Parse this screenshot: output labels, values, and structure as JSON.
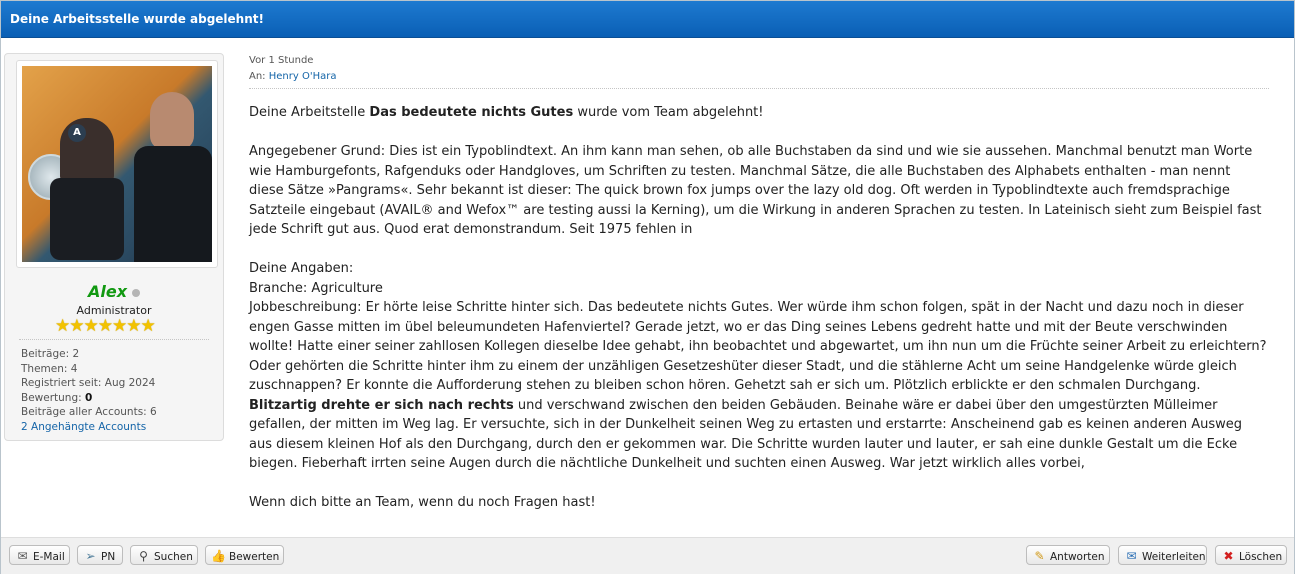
{
  "header": {
    "title": "Deine Arbeitsstelle wurde abgelehnt!"
  },
  "author": {
    "name": "Alex",
    "rank": "Administrator",
    "stars": "★★★★★★★",
    "stats": {
      "posts_label": "Beiträge:",
      "posts": "2",
      "threads_label": "Themen:",
      "threads": "4",
      "registered_label": "Registriert seit:",
      "registered": "Aug 2024",
      "rating_label": "Bewertung:",
      "rating": "0",
      "all_posts_label": "Beiträge aller Accounts:",
      "all_posts": "6",
      "linked_accounts": "2 Angehängte Accounts"
    }
  },
  "message": {
    "time": "Vor 1 Stunde",
    "to_label": "An:",
    "to_name": "Henry O'Hara",
    "line1_a": "Deine Arbeitstelle ",
    "line1_b": "Das bedeutete nichts Gutes",
    "line1_c": " wurde vom Team abgelehnt!",
    "reason": "Angegebener Grund: Dies ist ein Typoblindtext. An ihm kann man sehen, ob alle Buchstaben da sind und wie sie aussehen. Manchmal benutzt man Worte wie Hamburgefonts, Rafgenduks oder Handgloves, um Schriften zu testen. Manchmal Sätze, die alle Buchstaben des Alphabets enthalten - man nennt diese Sätze »Pangrams«. Sehr bekannt ist dieser: The quick brown fox jumps over the lazy old dog. Oft werden in Typoblindtexte auch fremdsprachige Satzteile eingebaut (AVAIL® and Wefox™ are testing aussi la Kerning), um die Wirkung in anderen Sprachen zu testen. In Lateinisch sieht zum Beispiel fast jede Schrift gut aus. Quod erat demonstrandum. Seit 1975 fehlen in",
    "details_label": "Deine Angaben:",
    "branch": "Branche: Agriculture",
    "job_a": "Jobbeschreibung: Er hörte leise Schritte hinter sich. Das bedeutete nichts Gutes. Wer würde ihm schon folgen, spät in der Nacht und dazu noch in dieser engen Gasse mitten im übel beleumundeten Hafenviertel? Gerade jetzt, wo er das Ding seines Lebens gedreht hatte und mit der Beute verschwinden wollte! Hatte einer seiner zahllosen Kollegen dieselbe Idee gehabt, ihn beobachtet und abgewartet, um ihn nun um die Früchte seiner Arbeit zu erleichtern? Oder gehörten die Schritte hinter ihm zu einem der unzähligen Gesetzeshüter dieser Stadt, und die stählerne Acht um seine Handgelenke würde gleich zuschnappen? Er konnte die Aufforderung stehen zu bleiben schon hören. Gehetzt sah er sich um. Plötzlich erblickte er den schmalen Durchgang. ",
    "job_b": "Blitzartig drehte er sich nach rechts",
    "job_c": " und verschwand zwischen den beiden Gebäuden. Beinahe wäre er dabei über den umgestürzten Mülleimer gefallen, der mitten im Weg lag. Er versuchte, sich in der Dunkelheit seinen Weg zu ertasten und erstarrte: Anscheinend gab es keinen anderen Ausweg aus diesem kleinen Hof als den Durchgang, durch den er gekommen war. Die Schritte wurden lauter und lauter, er sah eine dunkle Gestalt um die Ecke biegen. Fieberhaft irrten seine Augen durch die nächtliche Dunkelheit und suchten einen Ausweg. War jetzt wirklich alles vorbei,",
    "closing": "Wenn dich bitte an Team, wenn du noch Fragen hast!"
  },
  "buttons": {
    "email": "E-Mail",
    "pn": "PN",
    "search": "Suchen",
    "rate": "Bewerten",
    "reply": "Antworten",
    "forward": "Weiterleiten",
    "delete": "Löschen"
  }
}
